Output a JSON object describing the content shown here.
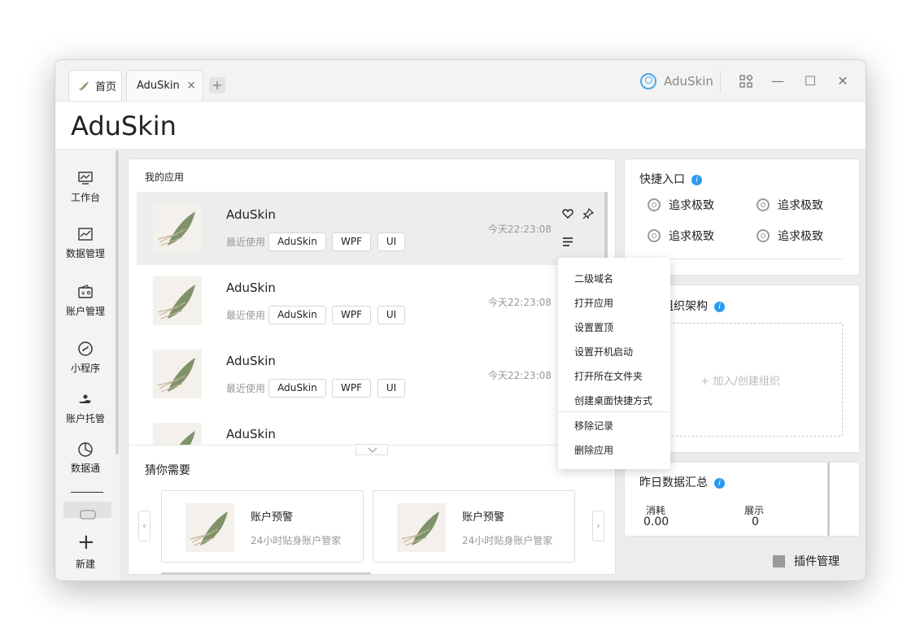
{
  "tabs": [
    {
      "label": "首页"
    },
    {
      "label": "AduSkin"
    }
  ],
  "tab_close": "×",
  "add_tab": "+",
  "user": {
    "name": "AduSkin"
  },
  "window_controls": {
    "apps": "apps-icon",
    "minimize": "—",
    "maximize": "☐",
    "close": "✕"
  },
  "header": {
    "title": "AduSkin"
  },
  "sidebar": {
    "items": [
      {
        "label": "工作台",
        "icon": "monitor-icon"
      },
      {
        "label": "数据管理",
        "icon": "chart-icon"
      },
      {
        "label": "账户管理",
        "icon": "wallet-icon"
      },
      {
        "label": "小程序",
        "icon": "miniapp-icon"
      },
      {
        "label": "账户托管",
        "icon": "hand-icon"
      },
      {
        "label": "数据通",
        "icon": "pie-icon"
      }
    ],
    "new_label": "新建"
  },
  "my_apps": {
    "title": "我的应用",
    "recent_label": "最近使用",
    "items": [
      {
        "name": "AduSkin",
        "tags": [
          "AduSkin",
          "WPF",
          "UI"
        ],
        "time": "今天22:23:08"
      },
      {
        "name": "AduSkin",
        "tags": [
          "AduSkin",
          "WPF",
          "UI"
        ],
        "time": "今天22:23:08"
      },
      {
        "name": "AduSkin",
        "tags": [
          "AduSkin",
          "WPF",
          "UI"
        ],
        "time": "今天22:23:08"
      },
      {
        "name": "AduSkin"
      }
    ]
  },
  "context_menu": {
    "items": [
      "二级域名",
      "打开应用",
      "设置置顶",
      "设置开机启动",
      "打开所在文件夹",
      "创建桌面快捷方式"
    ],
    "items2": [
      "移除记录",
      "删除应用"
    ]
  },
  "guess": {
    "title": "猜你需要",
    "cards": [
      {
        "title": "账户预警",
        "subtitle": "24小时贴身账户管家"
      },
      {
        "title": "账户预警",
        "subtitle": "24小时贴身账户管家"
      }
    ]
  },
  "quick": {
    "title": "快捷入口",
    "items": [
      "追求极致",
      "追求极致",
      "追求极致",
      "追求极致"
    ]
  },
  "org": {
    "title": "组织架构",
    "join": "+ 加入/创建组织"
  },
  "summary": {
    "title": "昨日数据汇总",
    "stats": [
      {
        "label": "消耗",
        "value": "0.00"
      },
      {
        "label": "展示",
        "value": "0"
      }
    ]
  },
  "plugin": {
    "label": "插件管理"
  },
  "colors": {
    "accent": "#2a9bf0",
    "selected_row": "#ededed"
  }
}
